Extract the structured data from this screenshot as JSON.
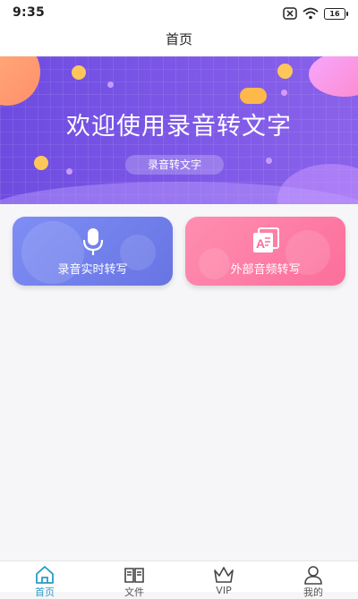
{
  "status_bar": {
    "time": "9:35",
    "battery": "16"
  },
  "header": {
    "title": "首页"
  },
  "banner": {
    "headline": "欢迎使用录音转文字",
    "button": "录音转文字"
  },
  "actions": [
    {
      "label": "录音实时转写",
      "icon": "microphone-icon",
      "color": "#6f7ceb"
    },
    {
      "label": "外部音频转写",
      "icon": "audio-file-import-icon",
      "color": "#fb7aa3"
    }
  ],
  "tabs": [
    {
      "label": "首页",
      "icon": "home-icon",
      "active": true
    },
    {
      "label": "文件",
      "icon": "book-icon",
      "active": false
    },
    {
      "label": "VIP",
      "icon": "crown-icon",
      "active": false
    },
    {
      "label": "我的",
      "icon": "user-icon",
      "active": false
    }
  ],
  "colors": {
    "accent": "#2a9ac8",
    "banner": "#7b56e6"
  }
}
